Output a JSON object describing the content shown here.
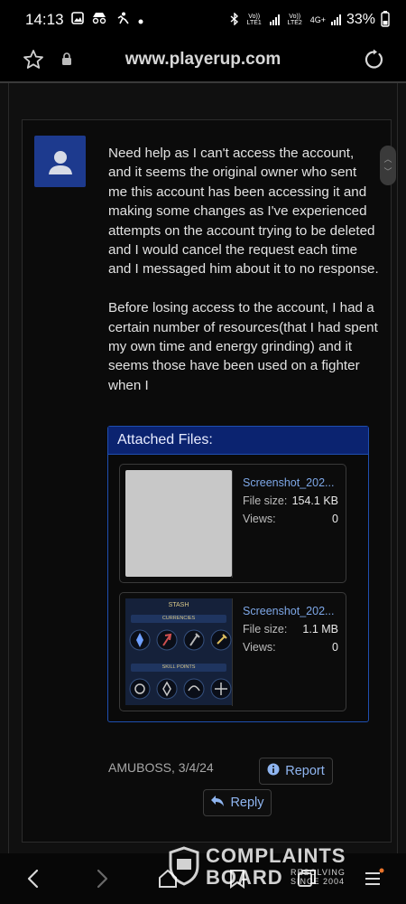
{
  "status_bar": {
    "time": "14:13",
    "network_1": "Vo)) LTE1",
    "network_2": "Vo)) LTE2",
    "network_type": "4G+",
    "battery": "33%"
  },
  "browser": {
    "url": "www.playerup.com"
  },
  "post": {
    "message_paragraphs": [
      "Need help as I can't access the account, and it seems the original owner who sent me this account has been accessing it and making some changes as I've experienced attempts on the account trying to be deleted and I would cancel the request each time and I messaged him about it to no response.",
      "Before losing access to the account, I had a certain number of resources(that I had spent my own time and energy grinding) and it seems those have been used on a fighter when I"
    ],
    "attachments": {
      "title": "Attached Files:",
      "size_label": "File size:",
      "views_label": "Views:",
      "files": [
        {
          "name": "Screenshot_202...",
          "size": "154.1 KB",
          "views": "0"
        },
        {
          "name": "Screenshot_202...",
          "size": "1.1 MB",
          "views": "0"
        }
      ],
      "stash_thumb": {
        "title": "STASH",
        "section_1": "CURRENCIES",
        "section_2": "SKILL POINTS"
      }
    },
    "meta": "AMUBOSS, 3/4/24",
    "report_label": "Report",
    "reply_label": "Reply"
  },
  "watermark": {
    "line1": "COMPLAINTS",
    "line2": "BOARD",
    "sub1": "RESOLVING",
    "sub2": "SINCE 2004"
  },
  "colors": {
    "accent_blue": "#1f4fb0",
    "header_blue": "#0b2370",
    "link_blue": "#7ea8e8",
    "avatar_blue": "#1d3a8e"
  }
}
